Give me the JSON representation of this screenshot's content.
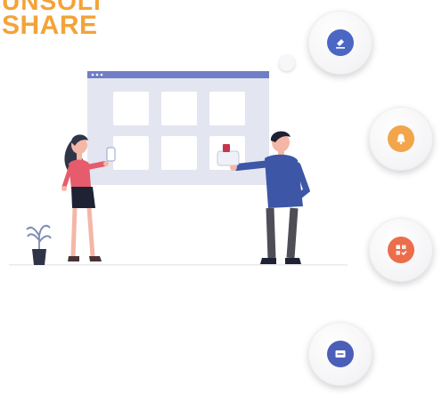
{
  "headline": {
    "line1": "UNSOLI",
    "line2": "SHARE",
    "color": "#f3a338"
  },
  "features": [
    {
      "icon": "pen-approve-icon",
      "color": "#4a67c4"
    },
    {
      "icon": "bell-icon",
      "color": "#f2a54a"
    },
    {
      "icon": "grid-check-icon",
      "color": "#ec6d4a"
    },
    {
      "icon": "card-icon",
      "color": "#4b5fb8"
    }
  ]
}
